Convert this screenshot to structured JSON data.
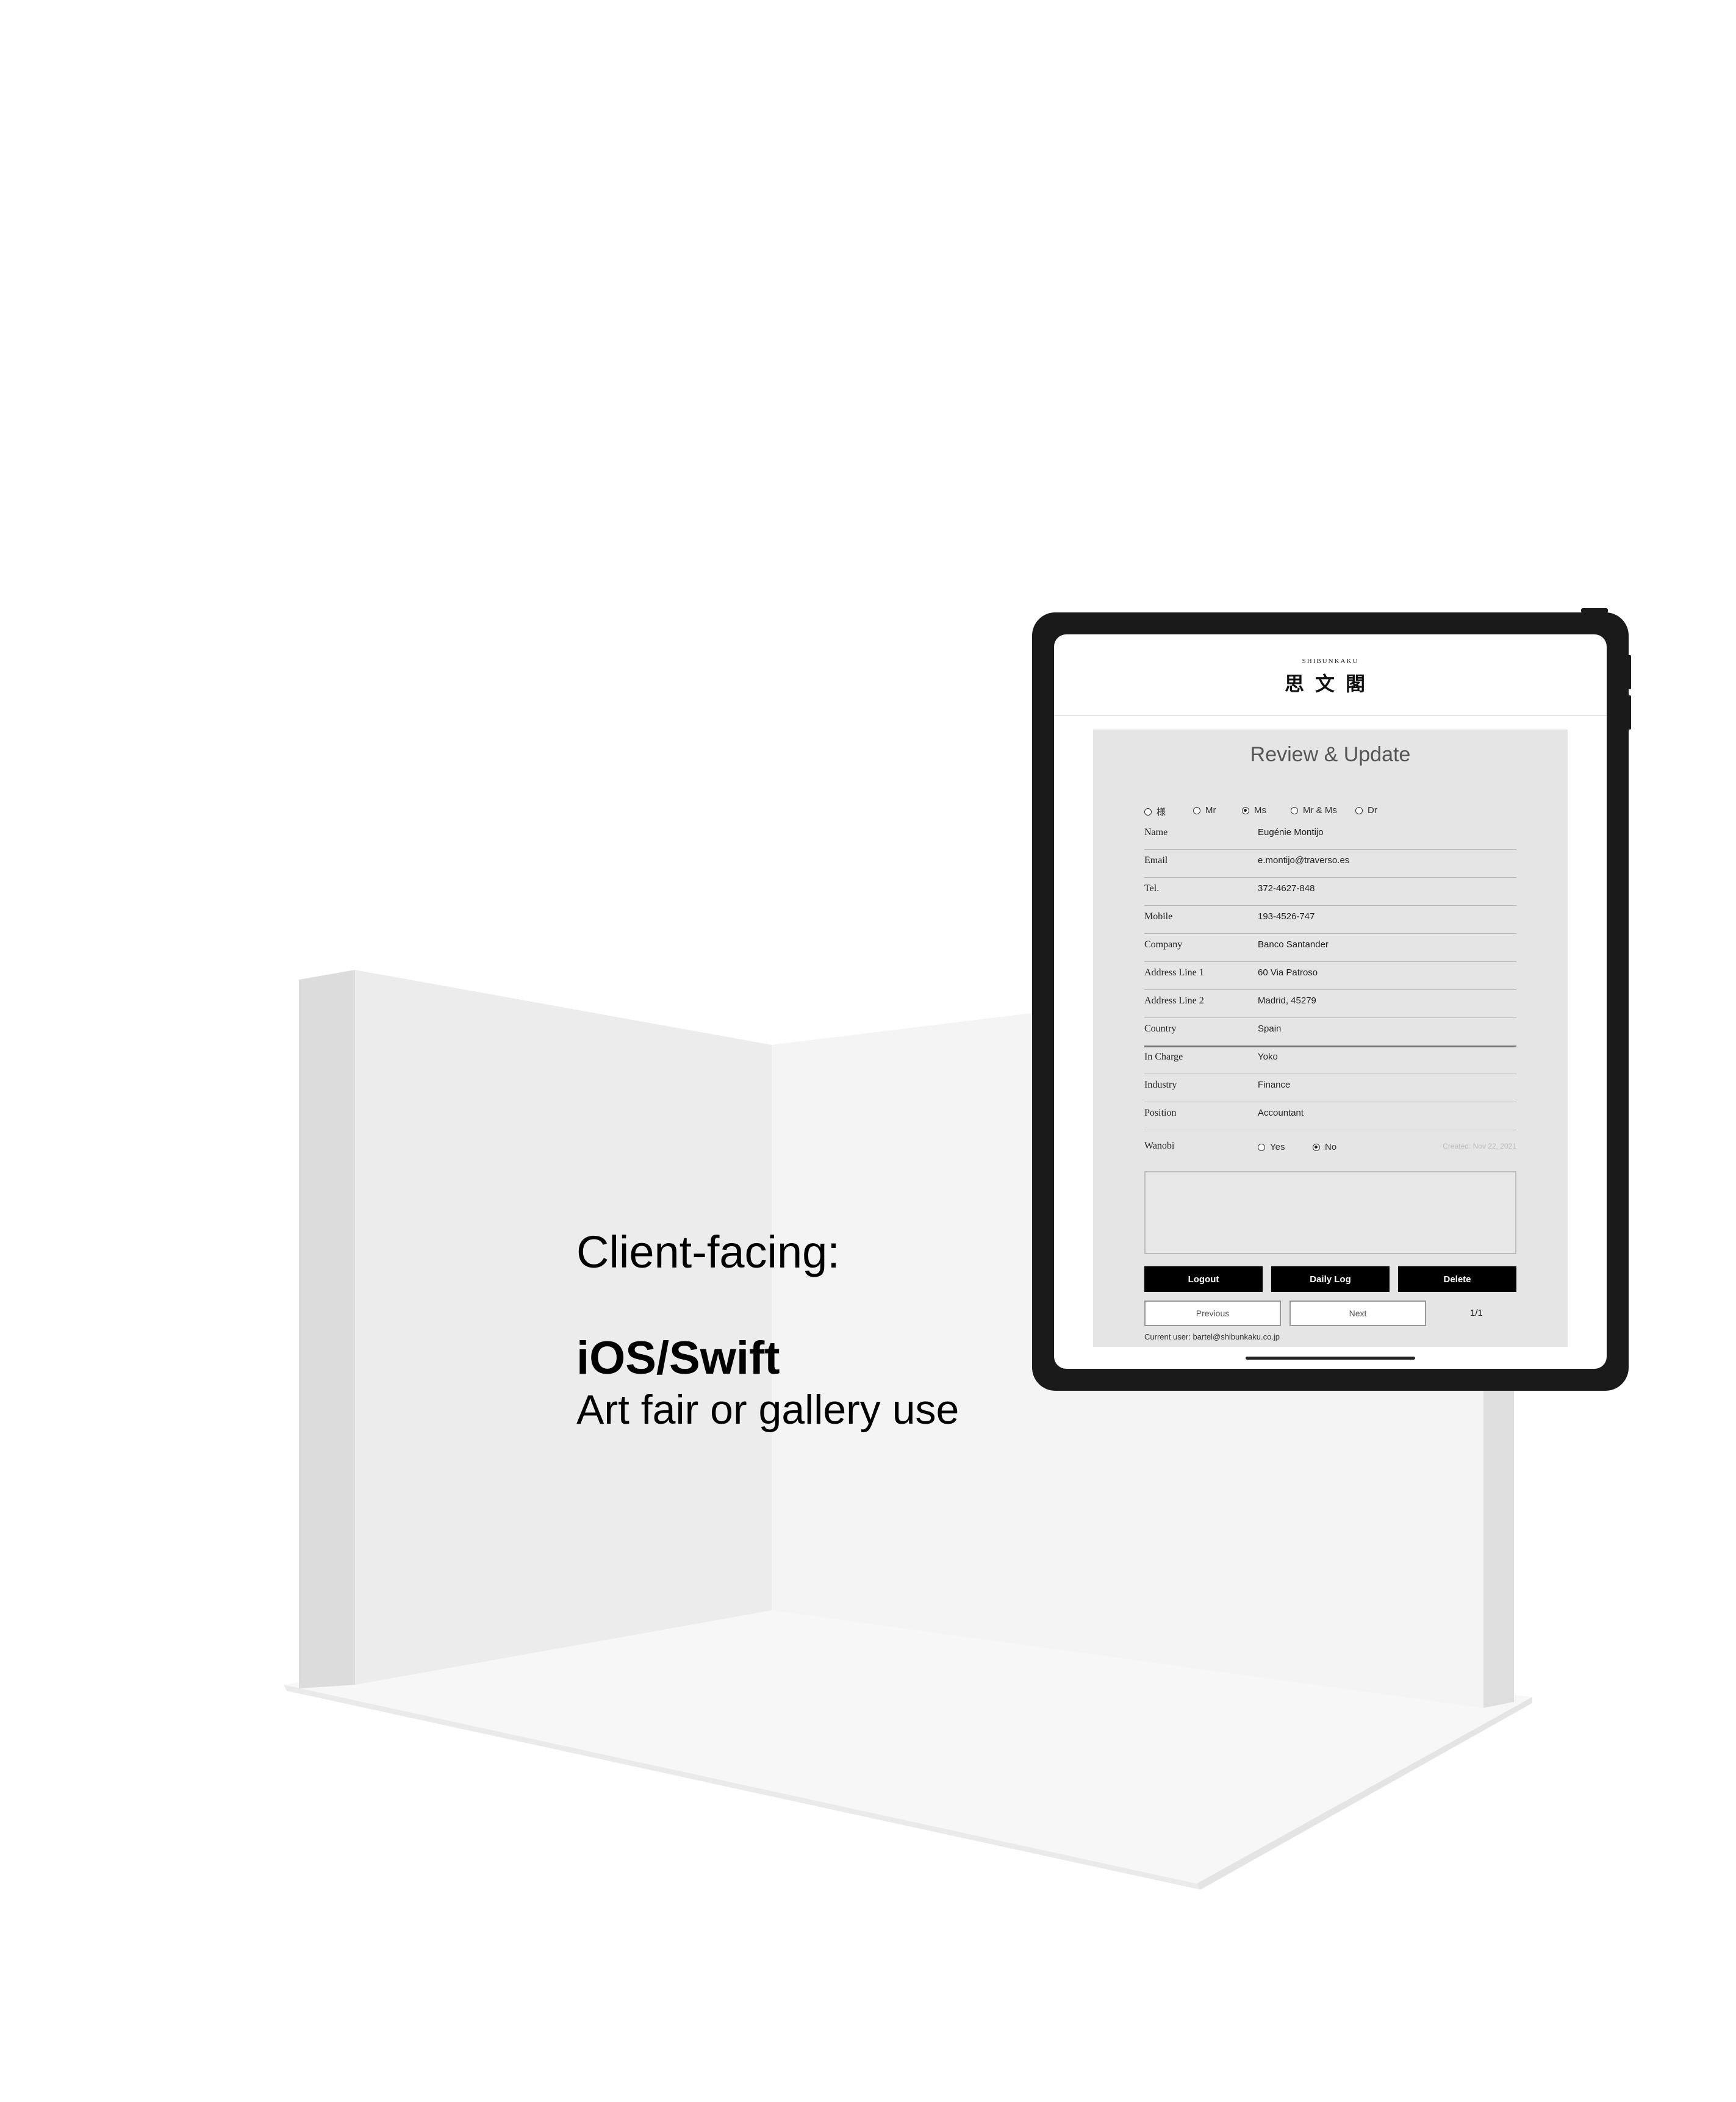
{
  "caption": {
    "line1": "Client-facing:",
    "line2": "iOS/Swift",
    "line3": "Art fair or gallery use"
  },
  "app": {
    "brand_small": "SHIBUNKAKU",
    "brand_logo": "思文閣",
    "title": "Review & Update",
    "salutations": [
      {
        "label": "様",
        "selected": false
      },
      {
        "label": "Mr",
        "selected": false
      },
      {
        "label": "Ms",
        "selected": true
      },
      {
        "label": "Mr & Ms",
        "selected": false
      },
      {
        "label": "Dr",
        "selected": false
      }
    ],
    "fields": [
      {
        "label": "Name",
        "value": "Eugénie Montijo"
      },
      {
        "label": "Email",
        "value": "e.montijo@traverso.es"
      },
      {
        "label": "Tel.",
        "value": "372-4627-848"
      },
      {
        "label": "Mobile",
        "value": "193-4526-747"
      },
      {
        "label": "Company",
        "value": "Banco Santander"
      },
      {
        "label": "Address Line 1",
        "value": "60 Via Patroso"
      },
      {
        "label": "Address Line 2",
        "value": "Madrid, 45279"
      },
      {
        "label": "Country",
        "value": "Spain"
      },
      {
        "label": "In Charge",
        "value": "Yoko"
      },
      {
        "label": "Industry",
        "value": "Finance"
      },
      {
        "label": "Position",
        "value": "Accountant"
      }
    ],
    "wanobi": {
      "label": "Wanobi",
      "options": [
        {
          "label": "Yes",
          "selected": false
        },
        {
          "label": "No",
          "selected": true
        }
      ],
      "created": "Created: Nov 22, 2021"
    },
    "notes": "",
    "buttons": {
      "logout": "Logout",
      "daily_log": "Daily Log",
      "delete": "Delete",
      "previous": "Previous",
      "next": "Next"
    },
    "page_indicator": "1/1",
    "current_user": "Current user: bartel@shibunkaku.co.jp"
  },
  "colors": {
    "panel_bg": "#e5e5e5",
    "button_dark": "#000000",
    "tablet_frame": "#1a1a1a"
  }
}
